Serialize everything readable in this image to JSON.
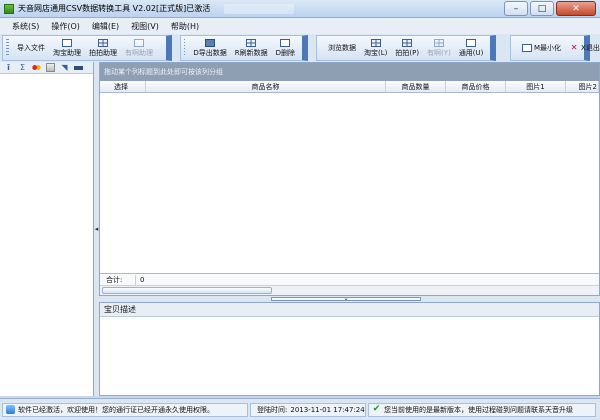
{
  "window": {
    "title": "天音网店通用CSV数据转换工具 V2.02[正式版]已激活",
    "minimize": "–",
    "maximize": "□",
    "close": "✕"
  },
  "menu": {
    "items": [
      "系统(S)",
      "操作(O)",
      "编辑(E)",
      "视图(V)",
      "帮助(H)"
    ]
  },
  "toolbar": {
    "group1": [
      {
        "label": "导入文件",
        "icon": "import-icon",
        "disabled": false
      },
      {
        "label": "淘宝助理",
        "icon": "taobao-icon",
        "disabled": false
      },
      {
        "label": "拍拍助理",
        "icon": "paipai-icon",
        "disabled": false
      },
      {
        "label": "有啊助理",
        "icon": "youa-icon",
        "disabled": true
      }
    ],
    "group2": [
      {
        "label": "D导出数据",
        "icon": "export-icon",
        "disabled": false
      },
      {
        "label": "R刷新数据",
        "icon": "refresh-icon",
        "disabled": false
      },
      {
        "label": "D删除",
        "icon": "delete-icon",
        "disabled": false
      }
    ],
    "group3": [
      {
        "label": "浏览数据",
        "icon": "",
        "disabled": false
      },
      {
        "label": "淘宝(L)",
        "icon": "taobao-browse-icon",
        "disabled": false
      },
      {
        "label": "拍拍(P)",
        "icon": "paipai-browse-icon",
        "disabled": false
      },
      {
        "label": "有啊(Y)",
        "icon": "youa-browse-icon",
        "disabled": true
      },
      {
        "label": "通用(U)",
        "icon": "general-icon",
        "disabled": false
      }
    ],
    "group4": [
      {
        "label": "M最小化",
        "icon": "minimize-icon",
        "disabled": false
      },
      {
        "label": "X退出",
        "icon": "exit-icon",
        "disabled": false
      }
    ]
  },
  "grid": {
    "group_hint": "拖动某个列标题到此处即可按该列分组",
    "columns": [
      "选择",
      "商品名称",
      "商品数量",
      "商品价格",
      "图片1",
      "图片2"
    ],
    "total_label": "合计:",
    "total_value": "0"
  },
  "description": {
    "title": "宝贝描述"
  },
  "status": {
    "message": "软件已经激活，欢迎使用！您的通行证已经开通永久使用权限。",
    "time_label": "登陆时间:",
    "time_value": "2013-11-01 17:47:24",
    "version_message": "您当前使用的是最新版本，使用过程碰到问题请联系天音升级"
  }
}
